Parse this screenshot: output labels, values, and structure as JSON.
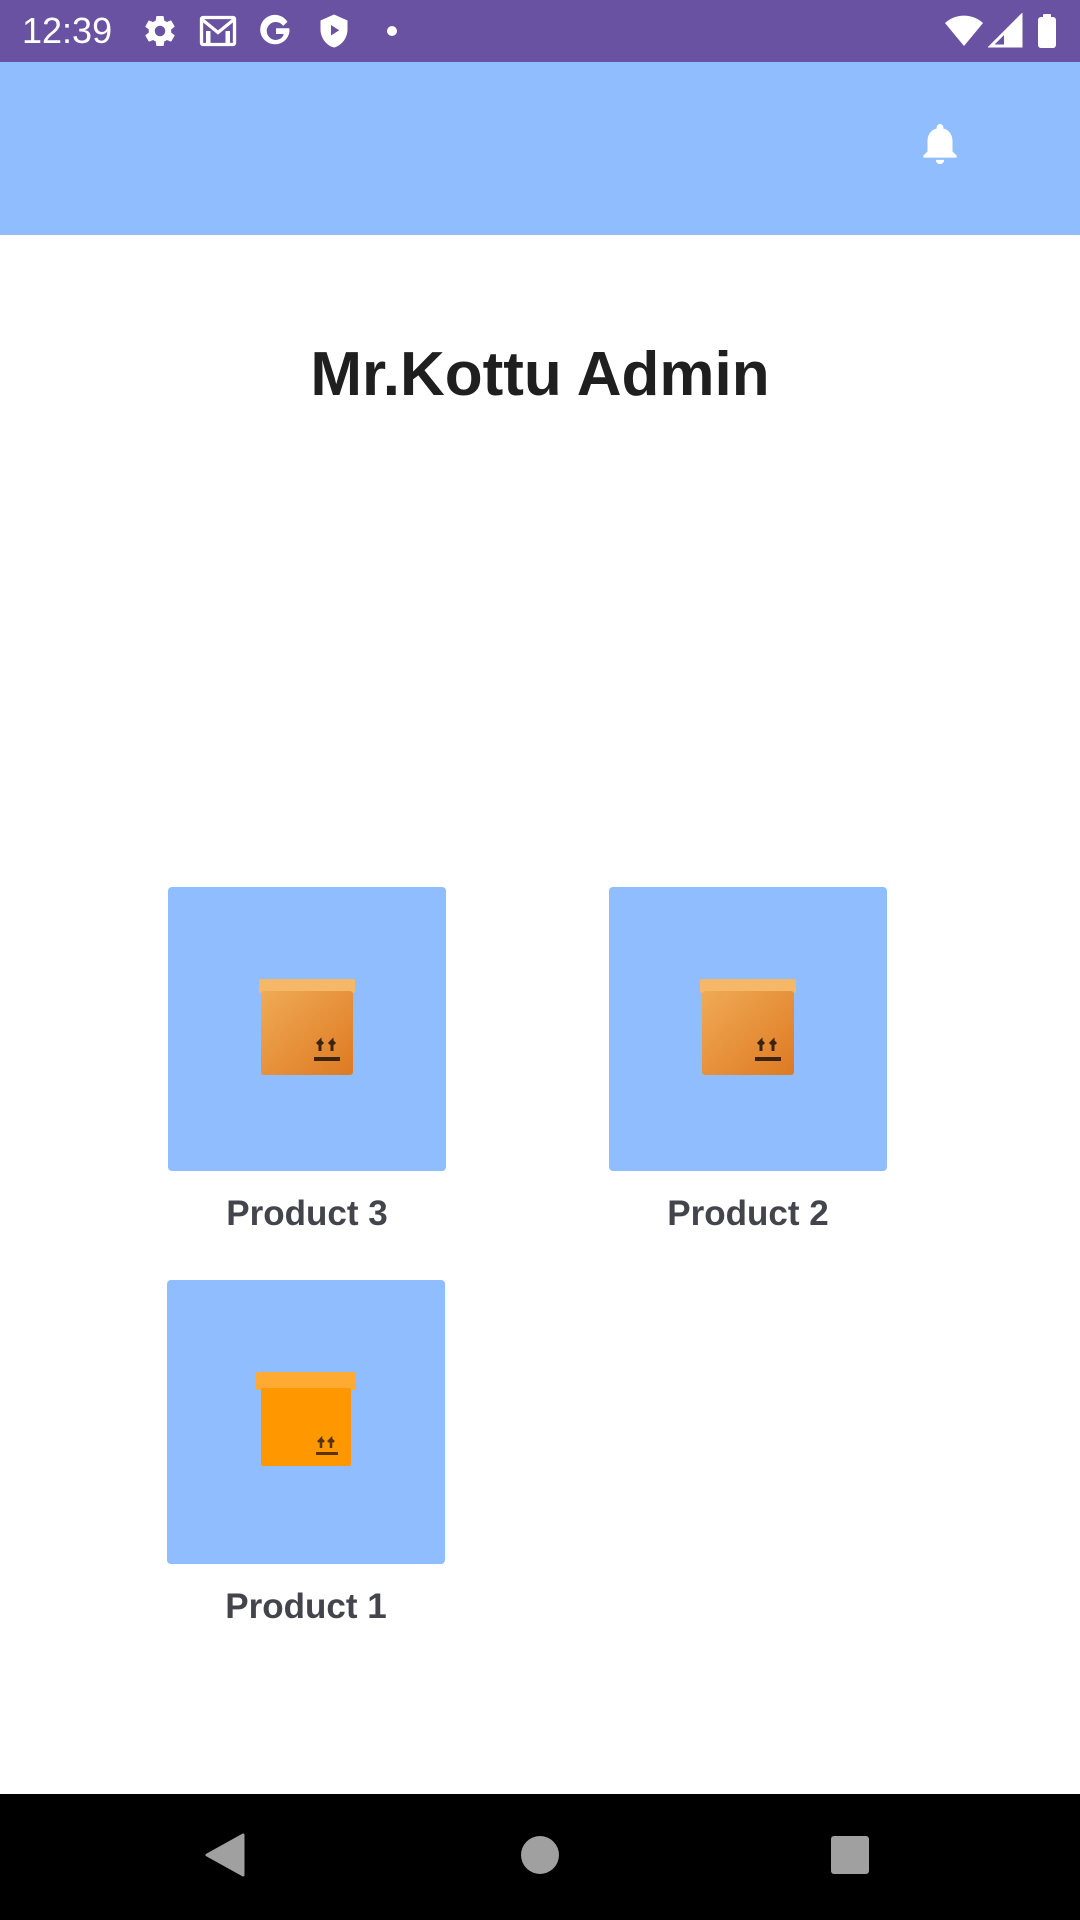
{
  "status_bar": {
    "time": "12:39",
    "color": "#6a52a3",
    "left_icons": [
      "settings-icon",
      "gmail-icon",
      "google-icon",
      "shield-play-icon",
      "dot-icon"
    ],
    "right_icons": [
      "wifi-icon",
      "signal-icon",
      "battery-icon"
    ]
  },
  "app_bar": {
    "color": "#90bdfd",
    "action_icon": "bell-icon"
  },
  "main": {
    "title": "Mr.Kottu Admin",
    "products": [
      {
        "label": "Product 3",
        "icon": "box-icon"
      },
      {
        "label": "Product 2",
        "icon": "box-icon"
      },
      {
        "label": "Product 1",
        "icon": "box-icon"
      }
    ]
  },
  "nav_bar": {
    "icons": [
      "back-icon",
      "home-icon",
      "recents-icon"
    ]
  }
}
